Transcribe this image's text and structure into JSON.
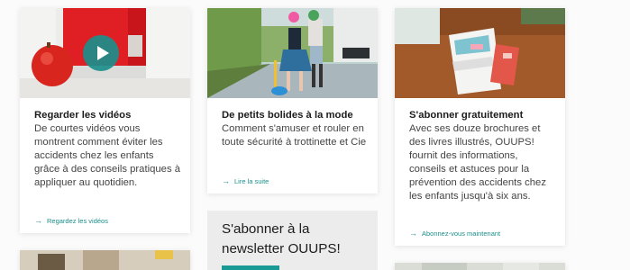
{
  "cards": [
    {
      "title": "Regarder les vidéos",
      "text": "De courtes vidéos vous montrent comment éviter les accidents chez les enfants grâce à des conseils pratiques à appliquer au quotidien.",
      "link": "Regardez les vidéos",
      "image_icon": "play-icon"
    },
    {
      "title": "De petits bolides à la mode",
      "text": "Comment s'amuser et rouler en toute sécurité à trottinette et Cie",
      "link": "Lire la suite"
    },
    {
      "title": "S'abonner gratuitement",
      "text": "Avec ses douze brochures et des livres illustrés, OUUPS! fournit des informations, conseils et astuces pour la prévention des accidents chez les enfants jusqu'à six ans.",
      "link": "Abonnez-vous maintenant"
    }
  ],
  "newsletter": {
    "title": "S'abonner à la newsletter OUUPS!"
  },
  "colors": {
    "accent": "#1b8f8b",
    "button": "#1a9a95",
    "newsletter_bg": "#ececec"
  }
}
